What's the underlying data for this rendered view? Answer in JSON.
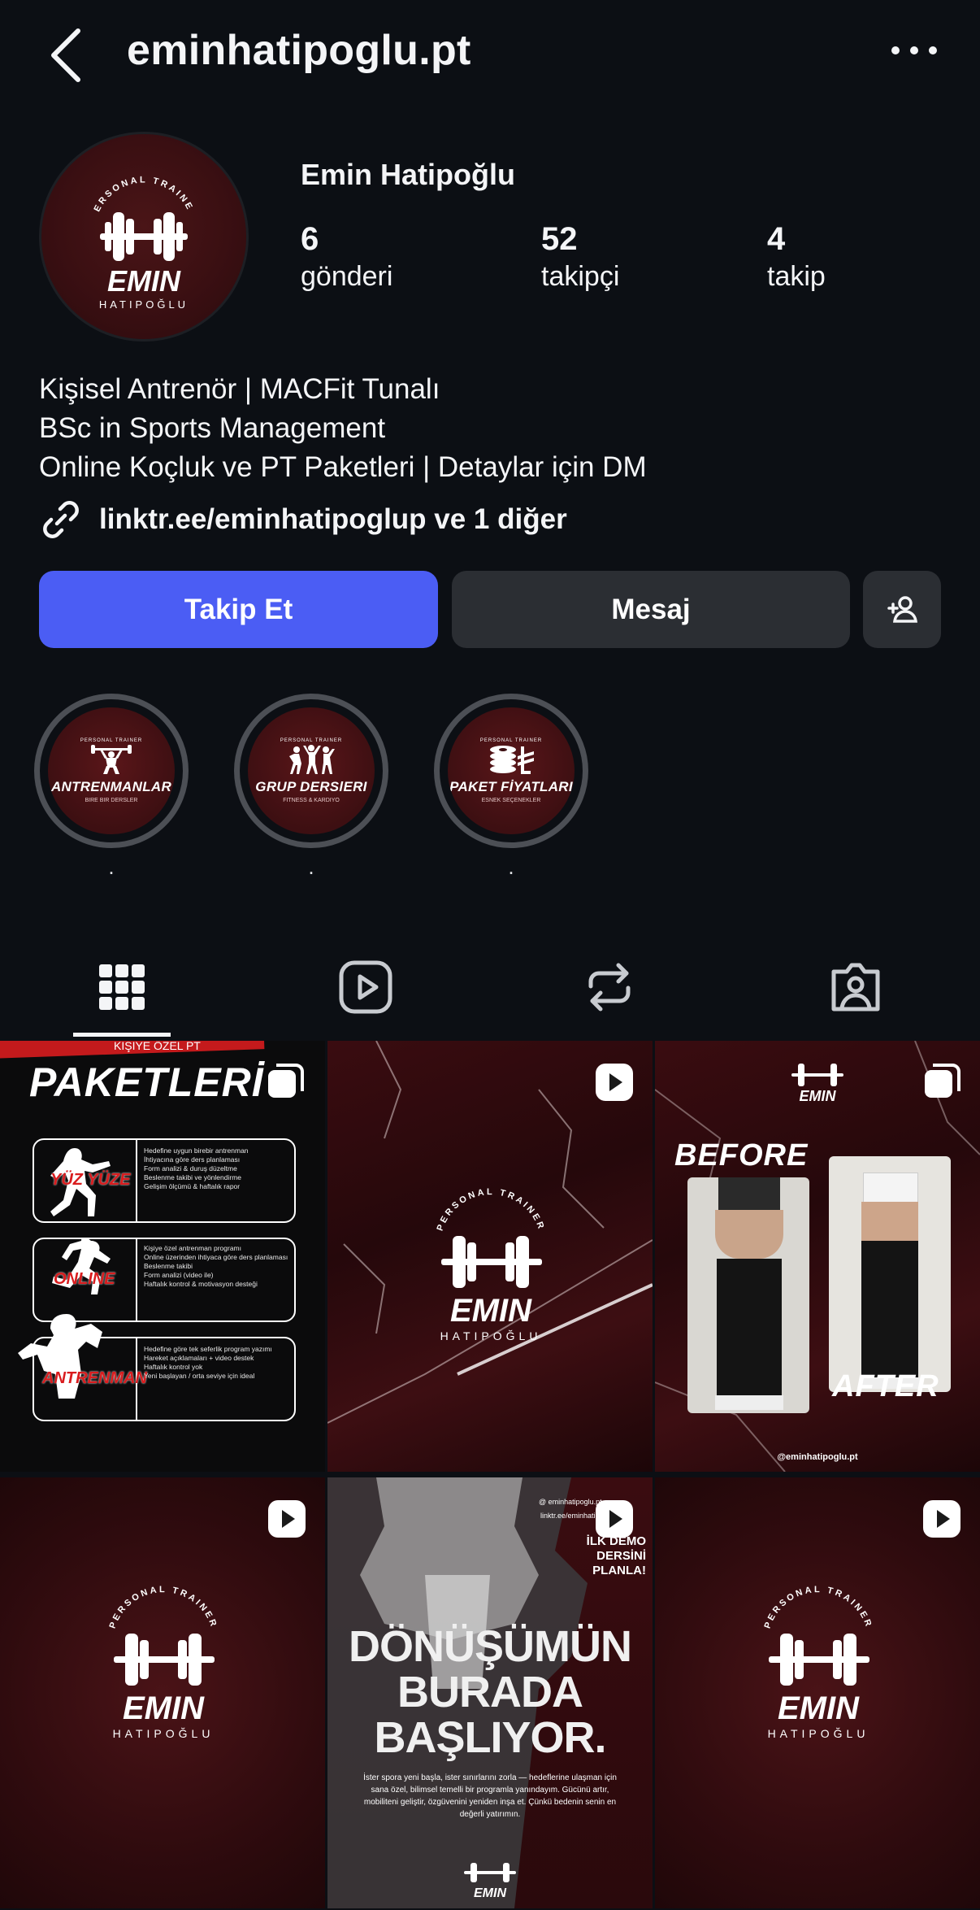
{
  "header": {
    "handle": "eminhatipoglu.pt"
  },
  "profile": {
    "name": "Emin Hatipoğlu",
    "avatar_logo": {
      "top": "PERSONAL TRAINER",
      "main": "EMIN",
      "sub": "HATIPOĞLU"
    },
    "stats": [
      {
        "value": "6",
        "label": "gönderi"
      },
      {
        "value": "52",
        "label": "takipçi"
      },
      {
        "value": "4",
        "label": "takip"
      }
    ],
    "bio": [
      "Kişisel Antrenör | MACFit Tunalı",
      "BSc in Sports Management",
      "Online Koçluk ve PT Paketleri | Detaylar için DM"
    ],
    "link": "linktr.ee/eminhatipoglup ve 1 diğer"
  },
  "actions": {
    "follow": "Takip Et",
    "message": "Mesaj"
  },
  "highlights": [
    {
      "title": "ANTRENMANLAR",
      "sub": "BIRE BIR DERSLER",
      "top": "PERSONAL TRAINER",
      "label": "."
    },
    {
      "title": "GRUP DERSlERI",
      "sub": "FITNESS & KARDIYO",
      "top": "PERSONAL TRAINER",
      "label": "."
    },
    {
      "title": "PAKET FİYATLARI",
      "sub": "ESNEK SEÇENEKLER",
      "top": "PERSONAL TRAINER",
      "label": "."
    }
  ],
  "posts": {
    "p1": {
      "kicker": "KİŞİYE ÖZEL PT",
      "title": "PAKETLERİ",
      "rows": [
        {
          "name": "YÜZ YÜZE",
          "text": "Hedefine uygun birebir antrenman\nİhtiyacına göre ders planlaması\nForm analizi & duruş düzeltme\nBeslenme takibi ve yönlendirme\nGelişim ölçümü & haftalık rapor"
        },
        {
          "name": "ONLINE",
          "text": "Kişiye özel antrenman programı\nOnline üzerinden ihtiyaca göre ders planlaması\nBeslenme takibi\nForm analizi (video ile)\nHaftalık kontrol & motivasyon desteği"
        },
        {
          "name": "ANTRENMAN",
          "text": "Hedefine göre tek seferlik program yazımı\nHareket açıklamaları + video destek\nHaftalık kontrol yok\nYeni başlayan / orta seviye için ideal"
        }
      ]
    },
    "p2": {
      "top": "PERSONAL TRAINER",
      "main": "EMIN",
      "sub": "HATIPOĞLU"
    },
    "p3": {
      "before": "BEFORE",
      "after": "AFTER",
      "handle": "@eminhatipoglu.pt",
      "logo_main": "EMIN"
    },
    "p4": {
      "top": "PERSONAL TRAINER",
      "main": "EMIN",
      "sub": "HATIPOĞLU"
    },
    "p5": {
      "contact1": "@ eminhatipoglu.pt",
      "contact2": "linktr.ee/eminhatipoglu",
      "cta": "İLK DEMO DERSİNİ PLANLA!",
      "headline1": "DÖNÜŞÜMÜN",
      "headline2": "BURADA",
      "headline3": "BAŞLIYOR.",
      "body": "İster spora yeni başla, ister sınırlarını zorla — hedeflerine ulaşman için sana özel, bilimsel temelli bir programla yanındayım. Gücünü artır, mobiliteni geliştir, özgüvenini yeniden inşa et. Çünkü bedenin senin en değerli yatırımın.",
      "logo": "EMIN"
    },
    "p6": {
      "top": "PERSONAL TRAINER",
      "main": "EMIN",
      "sub": "HATIPOĞLU"
    }
  },
  "colors": {
    "background": "#0c0f14",
    "follow_button": "#4b5df4",
    "secondary_button": "#2b2e33",
    "brand_red": "#3d0f12"
  },
  "icons": [
    "back-icon",
    "more-icon",
    "link-icon",
    "add-person-icon",
    "grid-icon",
    "reels-icon",
    "reposts-icon",
    "tagged-icon",
    "reel-badge-icon",
    "carousel-badge-icon"
  ]
}
